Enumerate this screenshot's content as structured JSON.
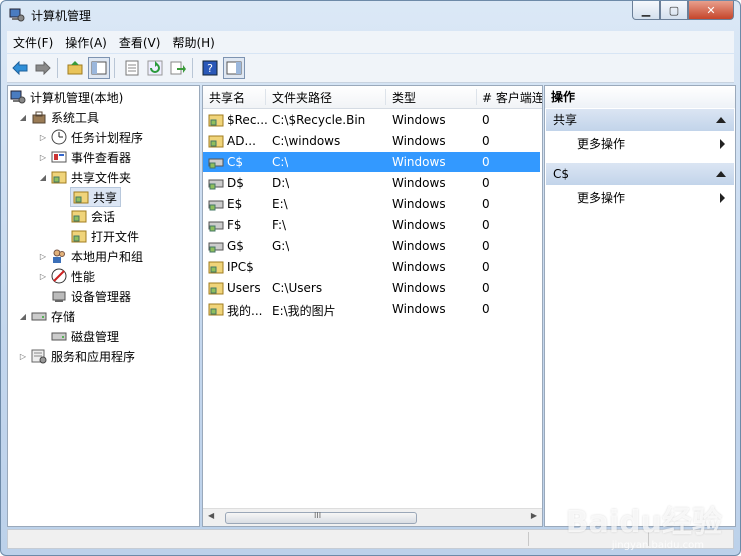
{
  "window": {
    "title": "计算机管理"
  },
  "menu": [
    "文件(F)",
    "操作(A)",
    "查看(V)",
    "帮助(H)"
  ],
  "tree": {
    "root": "计算机管理(本地)",
    "system_tools": "系统工具",
    "task_scheduler": "任务计划程序",
    "event_viewer": "事件查看器",
    "shared_folders": "共享文件夹",
    "shares": "共享",
    "sessions": "会话",
    "open_files": "打开文件",
    "local_users": "本地用户和组",
    "performance": "性能",
    "device_manager": "设备管理器",
    "storage": "存储",
    "disk_management": "磁盘管理",
    "services_apps": "服务和应用程序"
  },
  "list": {
    "columns": [
      "共享名",
      "文件夹路径",
      "类型",
      "# 客户端连"
    ],
    "rows": [
      {
        "name": "$Rec...",
        "path": "C:\\$Recycle.Bin",
        "type": "Windows",
        "clients": "0"
      },
      {
        "name": "AD...",
        "path": "C:\\windows",
        "type": "Windows",
        "clients": "0"
      },
      {
        "name": "C$",
        "path": "C:\\",
        "type": "Windows",
        "clients": "0"
      },
      {
        "name": "D$",
        "path": "D:\\",
        "type": "Windows",
        "clients": "0"
      },
      {
        "name": "E$",
        "path": "E:\\",
        "type": "Windows",
        "clients": "0"
      },
      {
        "name": "F$",
        "path": "F:\\",
        "type": "Windows",
        "clients": "0"
      },
      {
        "name": "G$",
        "path": "G:\\",
        "type": "Windows",
        "clients": "0"
      },
      {
        "name": "IPC$",
        "path": "",
        "type": "Windows",
        "clients": "0"
      },
      {
        "name": "Users",
        "path": "C:\\Users",
        "type": "Windows",
        "clients": "0"
      },
      {
        "name": "我的...",
        "path": "E:\\我的图片",
        "type": "Windows",
        "clients": "0"
      }
    ],
    "scroll_label": "III"
  },
  "actions": {
    "header": "操作",
    "section1": "共享",
    "section1_more": "更多操作",
    "section2": "C$",
    "section2_more": "更多操作"
  },
  "watermark": {
    "main": "Baidu经验",
    "sub": "jingyan.baidu.com"
  },
  "colors": {
    "selection": "#3399ff",
    "accent": "#c2d4ea"
  }
}
